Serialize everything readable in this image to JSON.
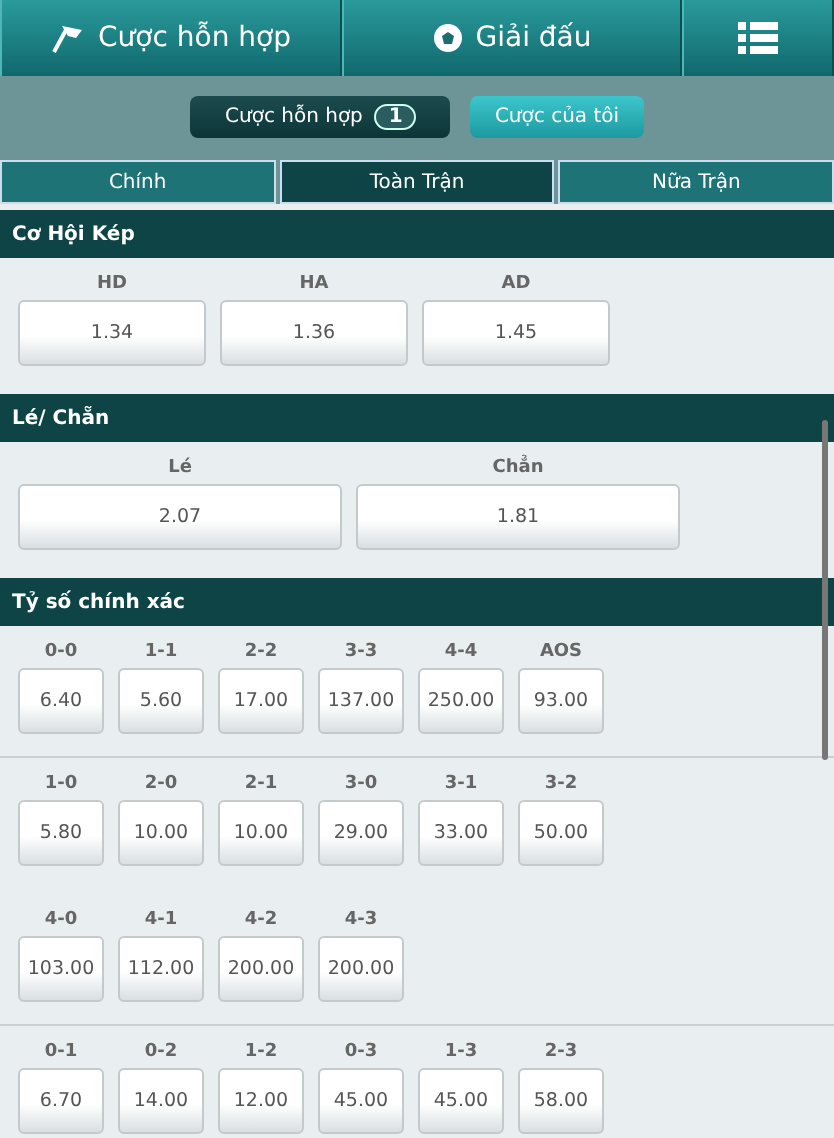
{
  "header": {
    "items": [
      {
        "kind": "flag",
        "label": "Cược hỗn hợp"
      },
      {
        "kind": "ball",
        "label": "Giải đấu"
      },
      {
        "kind": "menu"
      }
    ]
  },
  "subbar": {
    "buttons": [
      {
        "label": "Cược hỗn hợp",
        "count": "1",
        "selected": true
      },
      {
        "label": "Cược của tôi",
        "selected": false
      }
    ]
  },
  "tabs": [
    {
      "label": "Chính",
      "selected": false
    },
    {
      "label": "Toàn Trận",
      "selected": true
    },
    {
      "label": "Nữa Trận",
      "selected": false
    }
  ],
  "sections": [
    {
      "title": "Cơ Hội Kép",
      "kind": "medium",
      "groups": [
        [
          [
            {
              "label": "HD",
              "odds": "1.34"
            },
            {
              "label": "HA",
              "odds": "1.36"
            },
            {
              "label": "AD",
              "odds": "1.45"
            }
          ]
        ]
      ]
    },
    {
      "title": "Lé/ Chẵn",
      "kind": "wide",
      "groups": [
        [
          [
            {
              "label": "Lé",
              "odds": "2.07"
            },
            {
              "label": "Chẳn",
              "odds": "1.81"
            }
          ]
        ]
      ]
    },
    {
      "title": "Tỷ số chính xác",
      "kind": "small",
      "groups": [
        [
          [
            {
              "label": "0-0",
              "odds": "6.40"
            },
            {
              "label": "1-1",
              "odds": "5.60"
            },
            {
              "label": "2-2",
              "odds": "17.00"
            },
            {
              "label": "3-3",
              "odds": "137.00"
            },
            {
              "label": "4-4",
              "odds": "250.00"
            },
            {
              "label": "AOS",
              "odds": "93.00"
            }
          ]
        ],
        [
          [
            {
              "label": "1-0",
              "odds": "5.80"
            },
            {
              "label": "2-0",
              "odds": "10.00"
            },
            {
              "label": "2-1",
              "odds": "10.00"
            },
            {
              "label": "3-0",
              "odds": "29.00"
            },
            {
              "label": "3-1",
              "odds": "33.00"
            },
            {
              "label": "3-2",
              "odds": "50.00"
            }
          ],
          [
            {
              "label": "4-0",
              "odds": "103.00"
            },
            {
              "label": "4-1",
              "odds": "112.00"
            },
            {
              "label": "4-2",
              "odds": "200.00"
            },
            {
              "label": "4-3",
              "odds": "200.00"
            }
          ]
        ],
        [
          [
            {
              "label": "0-1",
              "odds": "6.70"
            },
            {
              "label": "0-2",
              "odds": "14.00"
            },
            {
              "label": "1-2",
              "odds": "12.00"
            },
            {
              "label": "0-3",
              "odds": "45.00"
            },
            {
              "label": "1-3",
              "odds": "45.00"
            },
            {
              "label": "2-3",
              "odds": "58.00"
            }
          ]
        ]
      ]
    }
  ]
}
